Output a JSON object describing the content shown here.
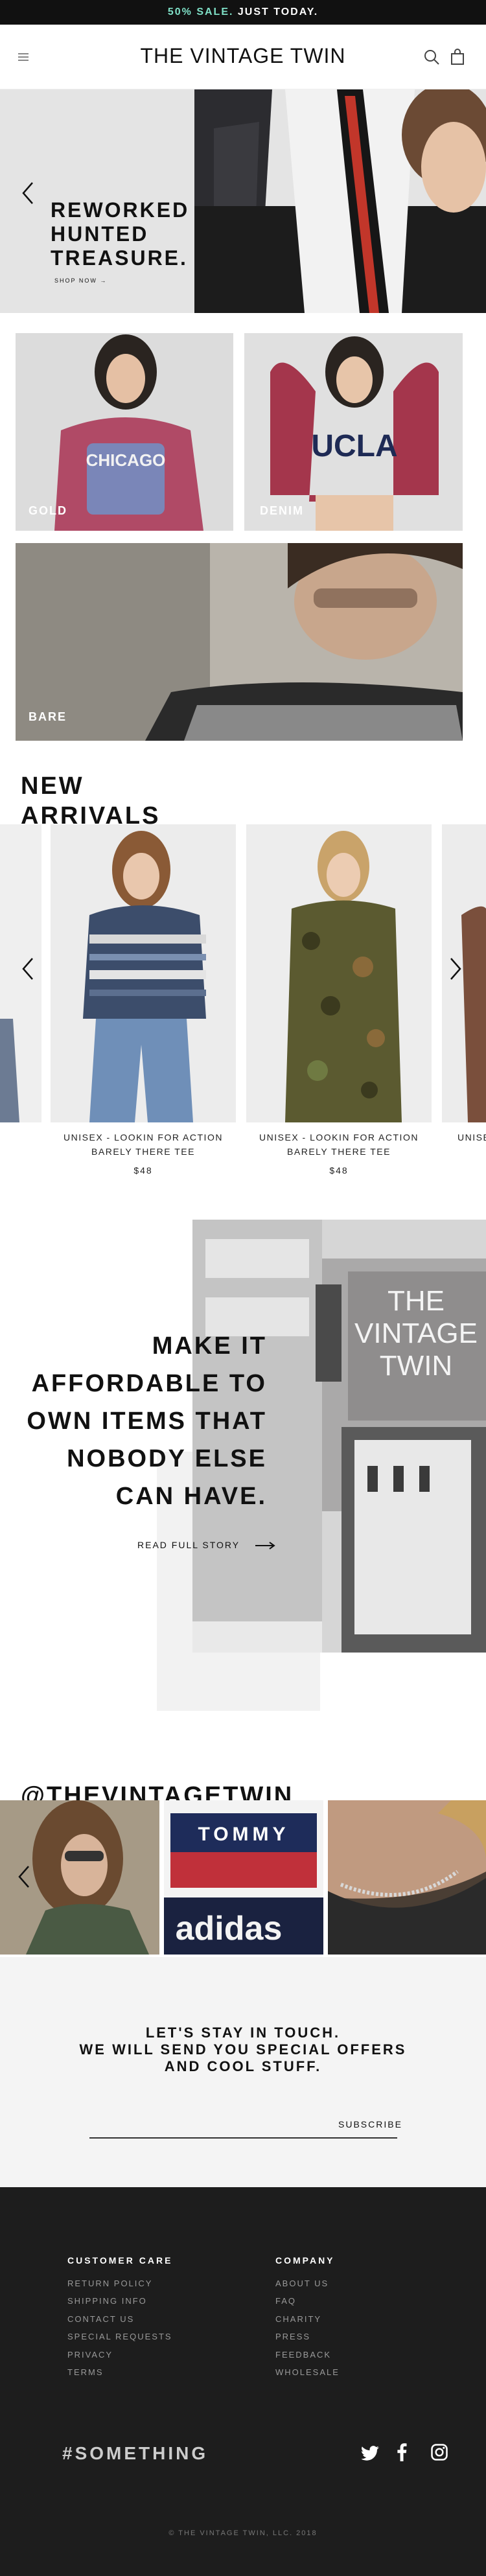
{
  "promo_bar": {
    "sale": "50% SALE.",
    "rest": " JUST TODAY."
  },
  "header": {
    "logo": "THE VINTAGE TWIN",
    "menu_icon": "hamburger-icon",
    "search_icon": "search-icon",
    "bag_icon": "shopping-bag-icon"
  },
  "hero": {
    "line1": "REWORKED",
    "line2": "HUNTED",
    "line3": "TREASURE.",
    "cta": "SHOP NOW →",
    "prev_icon": "chevron-left-icon"
  },
  "categories": [
    {
      "label": "GOLD",
      "shirt_text": "CHICAGO"
    },
    {
      "label": "DENIM",
      "shirt_text": "UCLA"
    },
    {
      "label": "BARE"
    }
  ],
  "new_arrivals": {
    "title_line1": "NEW",
    "title_line2": "ARRIVALS",
    "products": [
      {
        "name_line1": "UNISEX - LOOKIN FOR ACTION",
        "name_line2": "BARELY THERE TEE",
        "price": "$48"
      },
      {
        "name_line1": "UNISEX - LOOKIN FOR ACTION",
        "name_line2": "BARELY THERE TEE",
        "price": "$48"
      },
      {
        "name_line1": "UNISE"
      }
    ]
  },
  "story": {
    "line1": "MAKE IT",
    "line2": "AFFORDABLE TO",
    "line3": "OWN ITEMS THAT",
    "line4": "NOBODY ELSE",
    "line5": "CAN HAVE.",
    "cta": "READ FULL STORY",
    "sign_line1": "THE",
    "sign_line2": "VINTAGE",
    "sign_line3": "TWIN"
  },
  "instagram": {
    "handle": "@THEVINTAGETWIN",
    "tommy": "TOMMY",
    "adidas": "adidas"
  },
  "newsletter": {
    "line1": "LET'S STAY IN TOUCH.",
    "line2": "WE WILL SEND YOU SPECIAL OFFERS",
    "line3": "AND COOL STUFF.",
    "subscribe": "SUBSCRIBE"
  },
  "footer": {
    "customer_care": {
      "title": "CUSTOMER CARE",
      "links": [
        "RETURN POLICY",
        "SHIPPING INFO",
        "CONTACT US",
        "SPECIAL REQUESTS",
        "PRIVACY",
        "TERMS"
      ]
    },
    "company": {
      "title": "COMPANY",
      "links": [
        "ABOUT US",
        "FAQ",
        "CHARITY",
        "PRESS",
        "FEEDBACK",
        "WHOLESALE"
      ]
    },
    "hashtag": "#SOMETHING",
    "social_icons": [
      "twitter-icon",
      "facebook-icon",
      "instagram-icon"
    ],
    "copyright": "© THE VINTAGE TWIN, LLC. 2018"
  },
  "colors": {
    "accent_sale": "#7fe0c7",
    "footer_bg": "#1d1d1d",
    "text": "#111111"
  }
}
